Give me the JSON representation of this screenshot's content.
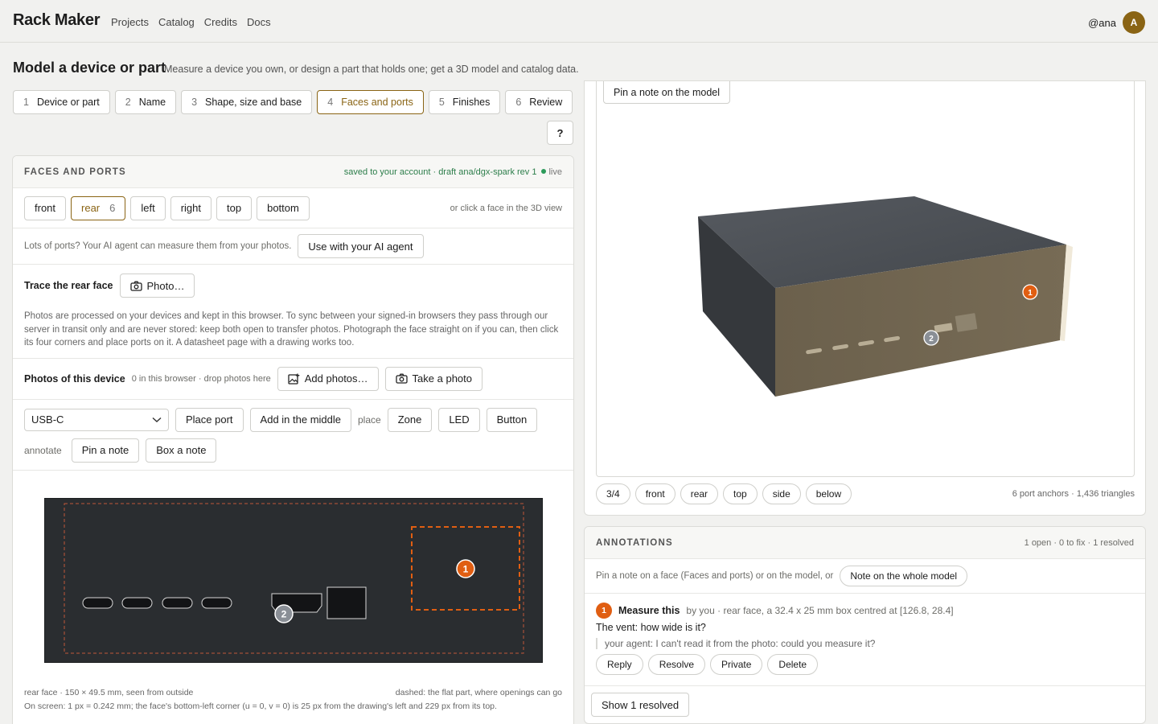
{
  "app": {
    "brand": "Rack Maker",
    "nav": [
      "Projects",
      "Catalog",
      "Credits",
      "Docs"
    ],
    "user": "@ana",
    "avatar_letter": "A"
  },
  "page": {
    "title": "Model a device or part",
    "subtitle": "Measure a device you own, or design a part that holds one; get a 3D model and catalog data."
  },
  "steps": [
    {
      "num": "1",
      "label": "Device or part"
    },
    {
      "num": "2",
      "label": "Name"
    },
    {
      "num": "3",
      "label": "Shape, size and base"
    },
    {
      "num": "4",
      "label": "Faces and ports",
      "active": true
    },
    {
      "num": "5",
      "label": "Finishes"
    },
    {
      "num": "6",
      "label": "Review"
    }
  ],
  "help_label": "?",
  "faces_panel": {
    "title": "FACES AND PORTS",
    "saved_status": "saved to your account · draft ana/dgx-spark rev 1",
    "live_label": "live",
    "faces": [
      "front",
      "rear",
      "left",
      "right",
      "top",
      "bottom"
    ],
    "rear_count": "6",
    "face_hint": "or click a face in the 3D view",
    "agent_text": "Lots of ports? Your AI agent can measure them from your photos.",
    "agent_button": "Use with your AI agent",
    "trace_label": "Trace the rear face",
    "photo_button": "Photo…",
    "trace_info": "Photos are processed on your devices and kept in this browser. To sync between your signed-in browsers they pass through our server in transit only and are never stored: keep both open to transfer photos. Photograph the face straight on if you can, then click its four corners and place ports on it. A datasheet page with a drawing works too.",
    "photos_label": "Photos of this device",
    "photos_hint": "0 in this browser · drop photos here",
    "add_photos": "Add photos…",
    "take_photo": "Take a photo",
    "port_type": "USB-C",
    "place_port": "Place port",
    "add_middle": "Add in the middle",
    "place_label": "place",
    "place_items": [
      "Zone",
      "LED",
      "Button"
    ],
    "annotate_label": "annotate",
    "pin_note": "Pin a note",
    "box_note": "Box a note",
    "drawing_pin_1": "1",
    "drawing_pin_2": "2",
    "face_info": "rear face · 150 × 49.5 mm, seen from outside",
    "dashed_info": "dashed: the flat part, where openings can go",
    "screen_info": "On screen: 1 px = 0.242 mm; the face's bottom-left corner (u = 0, v = 0) is 25 px from the drawing's left and 229 px from its top."
  },
  "viewer": {
    "pin_note_button": "Pin a note on the model",
    "pin_1": "1",
    "pin_2": "2",
    "views": [
      "3/4",
      "front",
      "rear",
      "top",
      "side",
      "below"
    ],
    "meta": "6 port anchors · 1,436 triangles"
  },
  "annotations": {
    "title": "ANNOTATIONS",
    "summary": "1 open · 0 to fix · 1 resolved",
    "pin_hint": "Pin a note on a face (Faces and ports) or on the model, or",
    "whole_model_button": "Note on the whole model",
    "item": {
      "badge": "1",
      "title": "Measure this",
      "meta": "by you · rear face, a 32.4 x 25 mm box centred at [126.8, 28.4]",
      "body": "The vent: how wide is it?",
      "reply": "your agent: I can't read it from the photo: could you measure it?",
      "actions": [
        "Reply",
        "Resolve",
        "Private",
        "Delete"
      ]
    },
    "show_resolved": "Show 1 resolved"
  },
  "colors": {
    "accent": "#8a6414",
    "pin_orange": "#e05e12",
    "pin_grey": "#8a8f96",
    "live_green": "#2c7d4a",
    "drawing_bg": "#2a2d30",
    "device_top": "#4b4e53",
    "device_rear": "#6f6450"
  }
}
